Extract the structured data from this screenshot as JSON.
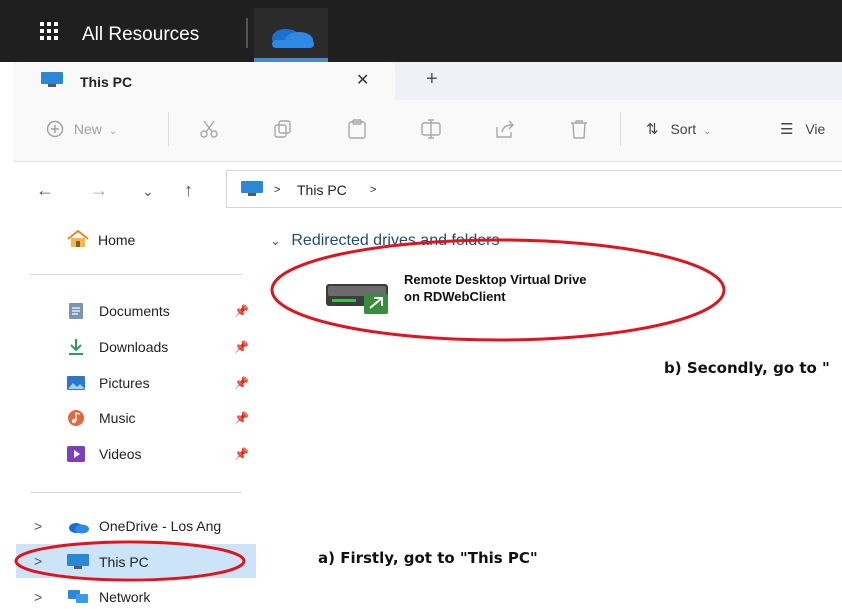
{
  "topbar": {
    "title": "All Resources",
    "apps_icon": "waffle-grid-icon",
    "active_tab_icon": "onedrive-cloud-icon"
  },
  "explorer_tab": {
    "title": "This PC",
    "close_glyph": "✕",
    "new_tab_glyph": "+"
  },
  "commandbar": {
    "new_label": "New",
    "sort_label": "Sort",
    "view_label": "Vie"
  },
  "address": {
    "segment": "This PC",
    "sep_glyph": ">"
  },
  "sidebar": {
    "home": "Home",
    "quick_access": [
      {
        "label": "Documents",
        "icon": "documents-icon"
      },
      {
        "label": "Downloads",
        "icon": "downloads-icon"
      },
      {
        "label": "Pictures",
        "icon": "pictures-icon"
      },
      {
        "label": "Music",
        "icon": "music-icon"
      },
      {
        "label": "Videos",
        "icon": "videos-icon"
      }
    ],
    "onedrive": "OneDrive - Los Ang",
    "this_pc": "This PC",
    "network": "Network"
  },
  "main": {
    "group_title": "Redirected drives and folders",
    "drive_line1": "Remote Desktop Virtual Drive",
    "drive_line2": "on RDWebClient"
  },
  "annotations": {
    "step_a": "a) Firstly, got to \"This PC\"",
    "step_b": "b) Secondly, go to \""
  },
  "colors": {
    "highlight_circle": "#e0141e",
    "selection": "#cce4f7",
    "titlebar": "#1f1f1f"
  }
}
